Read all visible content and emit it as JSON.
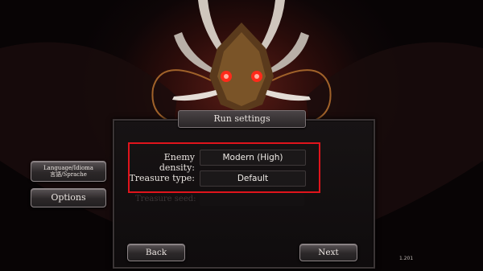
{
  "panel": {
    "title": "Run settings",
    "enemy_density_label": "Enemy density:",
    "enemy_density_value": "Modern (High)",
    "treasure_type_label": "Treasure type:",
    "treasure_type_value": "Default",
    "treasure_seed_label": "Treasure seed:"
  },
  "sidebar": {
    "language_line1": "Language/Idioma",
    "language_line2": "言語/Sprache",
    "options_label": "Options"
  },
  "nav": {
    "back_label": "Back",
    "next_label": "Next"
  },
  "version": "1.201",
  "colors": {
    "highlight": "#e0141c",
    "eye_glow": "#ff2a1a"
  }
}
